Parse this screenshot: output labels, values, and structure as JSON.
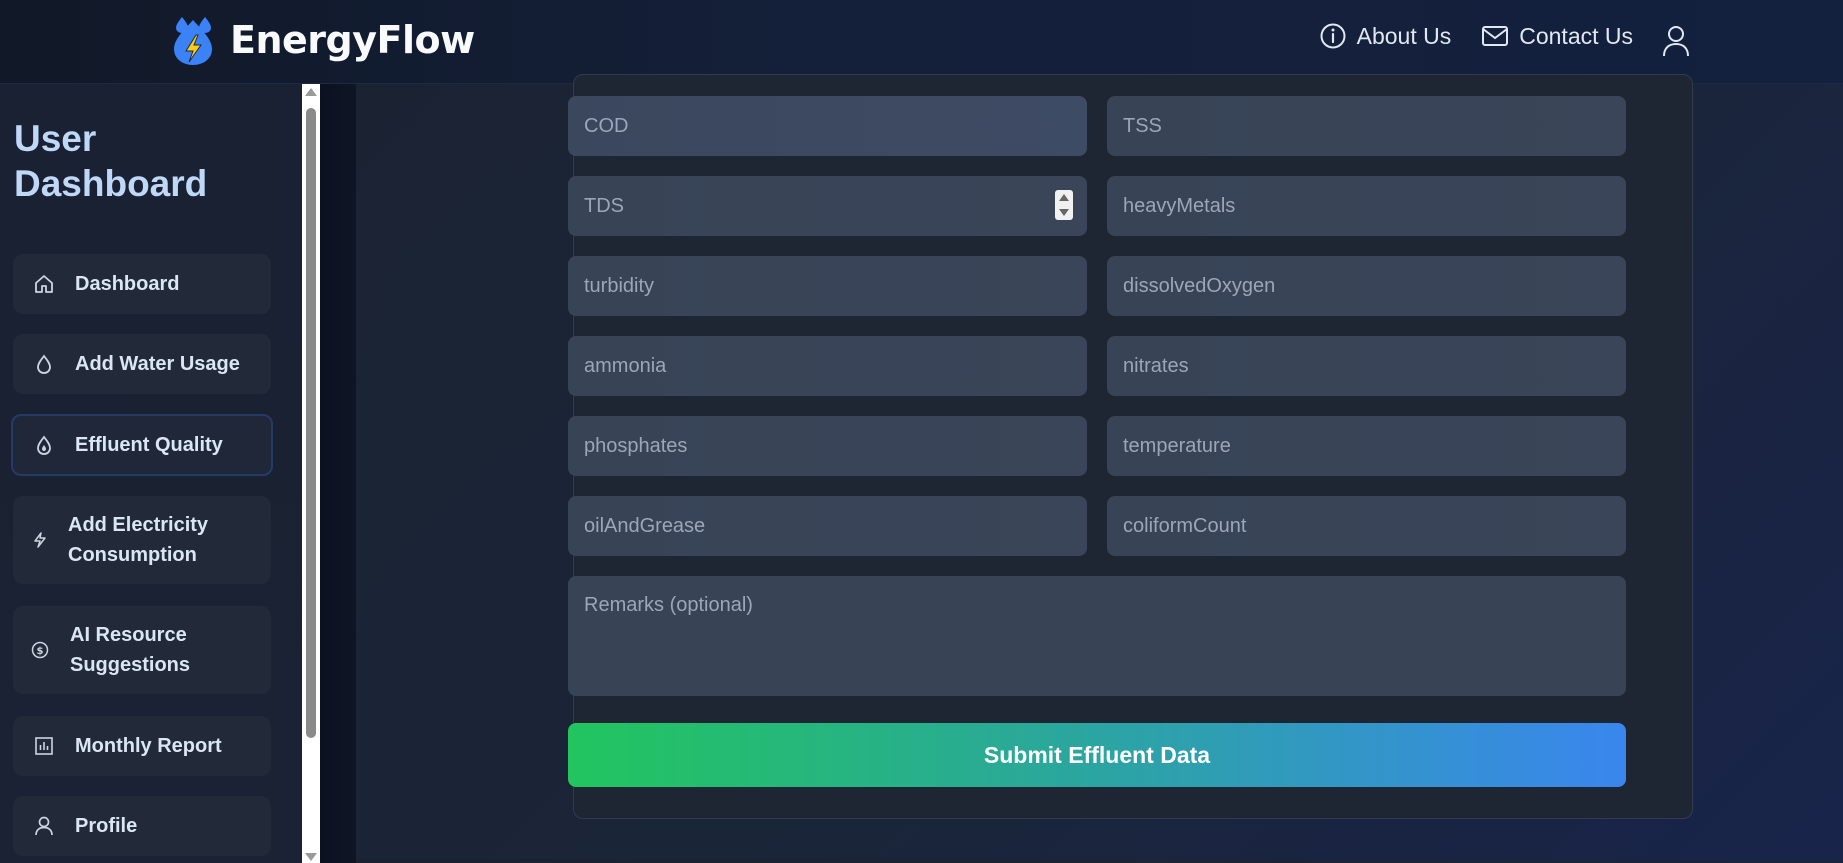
{
  "header": {
    "brand": "EnergyFlow",
    "nav": [
      {
        "label": "About Us",
        "icon": "info-icon"
      },
      {
        "label": "Contact Us",
        "icon": "mail-icon"
      }
    ],
    "user_icon": "user-icon"
  },
  "sidebar": {
    "title": "User Dashboard",
    "items": [
      {
        "label": "Dashboard",
        "icon": "home-icon"
      },
      {
        "label": "Add Water Usage",
        "icon": "droplet-icon"
      },
      {
        "label": "Effluent Quality",
        "icon": "droplet-icon",
        "active": true
      },
      {
        "label": "Add Electricity Consumption",
        "icon": "lightning-icon"
      },
      {
        "label": "AI Resource Suggestions",
        "icon": "dollar-circle-icon"
      },
      {
        "label": "Monthly Report",
        "icon": "bar-chart-icon"
      },
      {
        "label": "Profile",
        "icon": "user-icon"
      }
    ]
  },
  "form": {
    "fields": [
      {
        "placeholder": "COD"
      },
      {
        "placeholder": "TSS"
      },
      {
        "placeholder": "TDS"
      },
      {
        "placeholder": "heavyMetals"
      },
      {
        "placeholder": "turbidity"
      },
      {
        "placeholder": "dissolvedOxygen"
      },
      {
        "placeholder": "ammonia"
      },
      {
        "placeholder": "nitrates"
      },
      {
        "placeholder": "phosphates"
      },
      {
        "placeholder": "temperature"
      },
      {
        "placeholder": "oilAndGrease"
      },
      {
        "placeholder": "coliformCount"
      }
    ],
    "remarks_placeholder": "Remarks (optional)",
    "submit_label": "Submit Effluent Data"
  },
  "colors": {
    "accent_blue": "#3b82f6",
    "accent_green": "#22c55e",
    "sidebar_title": "#bfd8f7"
  }
}
